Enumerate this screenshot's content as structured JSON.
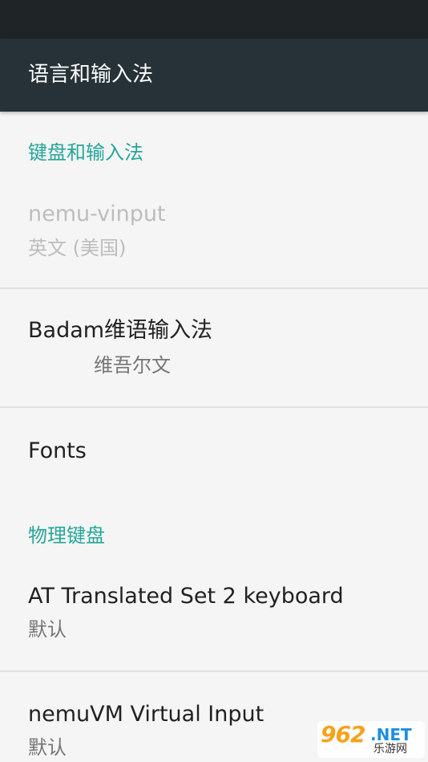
{
  "app_bar": {
    "title": "语言和输入法"
  },
  "sections": {
    "keyboard_input": {
      "header": "键盘和输入法"
    },
    "physical_keyboard": {
      "header": "物理键盘"
    }
  },
  "items": {
    "nemu_vinput": {
      "title": "nemu-vinput",
      "summary": "英文 (美国)",
      "enabled": false
    },
    "badam": {
      "title": "Badam维语输入法",
      "summary": "维吾尔文"
    },
    "fonts": {
      "title": "Fonts"
    },
    "at_keyboard": {
      "title": "AT Translated Set 2 keyboard",
      "summary": "默认"
    },
    "nemuvm_input": {
      "title": "nemuVM Virtual Input",
      "summary": "默认"
    }
  },
  "watermark": {
    "logo": "962",
    "net": ".NET",
    "sub": "乐游网"
  },
  "colors": {
    "status_bar": "#1f2427",
    "app_bar": "#263238",
    "accent": "#26a69a",
    "background": "#f5f5f5"
  }
}
